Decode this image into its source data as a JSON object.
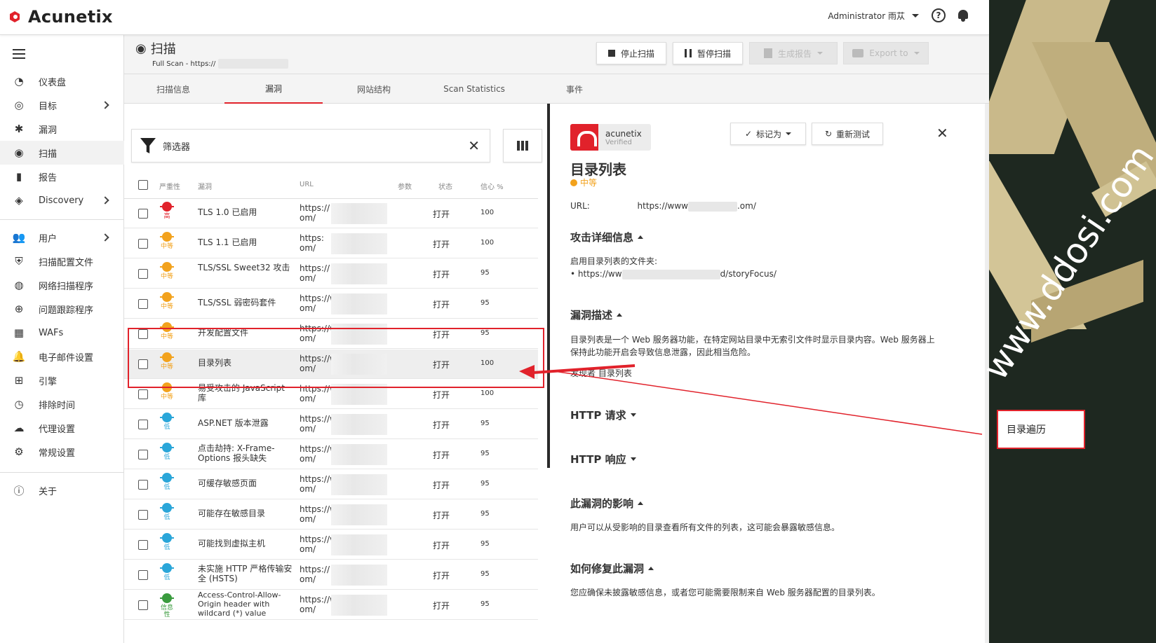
{
  "topbar": {
    "logo": "Acunetix",
    "user": "Administrator 雨苁",
    "help": "?"
  },
  "sidebar": {
    "items": [
      {
        "label": "仪表盘",
        "icon": "dashboard-icon"
      },
      {
        "label": "目标",
        "icon": "target-icon"
      },
      {
        "label": "漏洞",
        "icon": "bug-icon"
      },
      {
        "label": "扫描",
        "icon": "scan-icon"
      },
      {
        "label": "报告",
        "icon": "report-icon"
      },
      {
        "label": "Discovery",
        "icon": "compass-icon"
      },
      {
        "label": "用户",
        "icon": "users-icon"
      },
      {
        "label": "扫描配置文件",
        "icon": "shield-icon"
      },
      {
        "label": "网络扫描程序",
        "icon": "network-scanner-icon"
      },
      {
        "label": "问题跟踪程序",
        "icon": "issue-tracker-icon"
      },
      {
        "label": "WAFs",
        "icon": "waf-icon"
      },
      {
        "label": "电子邮件设置",
        "icon": "bell-icon"
      },
      {
        "label": "引擎",
        "icon": "chip-icon"
      },
      {
        "label": "排除时间",
        "icon": "clock-icon"
      },
      {
        "label": "代理设置",
        "icon": "cloud-icon"
      },
      {
        "label": "常规设置",
        "icon": "gear-icon"
      },
      {
        "label": "关于",
        "icon": "info-icon"
      }
    ]
  },
  "header": {
    "title": "扫描",
    "subtitle": "Full Scan - https://",
    "stop": "停止扫描",
    "pause": "暂停扫描",
    "report": "生成报告",
    "export": "Export to"
  },
  "tabs": [
    "扫描信息",
    "漏洞",
    "网站结构",
    "Scan Statistics",
    "事件"
  ],
  "filter": {
    "label": "筛选器"
  },
  "table": {
    "headers": {
      "severity": "严重性",
      "vuln": "漏洞",
      "url": "URL",
      "params": "参数",
      "status": "状态",
      "confidence": "信心 %"
    },
    "rows": [
      {
        "sev": "高",
        "color": "#e1222b",
        "name": "TLS 1.0 已启用",
        "url1": "https://",
        "url2": "om/",
        "status": "打开",
        "conf": "100"
      },
      {
        "sev": "中等",
        "color": "#f2a21d",
        "name": "TLS 1.1 已启用",
        "url1": "https:",
        "url2": "om/",
        "status": "打开",
        "conf": "100"
      },
      {
        "sev": "中等",
        "color": "#f2a21d",
        "name": "TLS/SSL Sweet32 攻击",
        "url1": "https://",
        "url2": "om/",
        "status": "打开",
        "conf": "95"
      },
      {
        "sev": "中等",
        "color": "#f2a21d",
        "name": "TLS/SSL 弱密码套件",
        "url1": "https://w",
        "url2": "om/",
        "status": "打开",
        "conf": "95"
      },
      {
        "sev": "中等",
        "color": "#f2a21d",
        "name": "开发配置文件",
        "url1": "https://wv",
        "url2": "om/",
        "status": "打开",
        "conf": "95"
      },
      {
        "sev": "中等",
        "color": "#f2a21d",
        "name": "目录列表",
        "url1": "https://ww",
        "url2": "om/",
        "status": "打开",
        "conf": "100"
      },
      {
        "sev": "中等",
        "color": "#f2a21d",
        "name": "易受攻击的 JavaScript 库",
        "url1": "https://ww",
        "url2": "om/",
        "status": "打开",
        "conf": "100"
      },
      {
        "sev": "低",
        "color": "#2aa6d9",
        "name": "ASP.NET 版本泄露",
        "url1": "https://wv",
        "url2": "om/",
        "status": "打开",
        "conf": "95"
      },
      {
        "sev": "低",
        "color": "#2aa6d9",
        "name": "点击劫持: X-Frame-Options 报头缺失",
        "url1": "https://wv",
        "url2": "om/",
        "status": "打开",
        "conf": "95"
      },
      {
        "sev": "低",
        "color": "#2aa6d9",
        "name": "可缓存敏感页面",
        "url1": "https://wv",
        "url2": "om/",
        "status": "打开",
        "conf": "95"
      },
      {
        "sev": "低",
        "color": "#2aa6d9",
        "name": "可能存在敏感目录",
        "url1": "https://w",
        "url2": "om/",
        "status": "打开",
        "conf": "95"
      },
      {
        "sev": "低",
        "color": "#2aa6d9",
        "name": "可能找到虚拟主机",
        "url1": "https://v",
        "url2": "om/",
        "status": "打开",
        "conf": "95"
      },
      {
        "sev": "低",
        "color": "#2aa6d9",
        "name": "未实施 HTTP 严格传输安全 (HSTS)",
        "url1": "https://",
        "url2": "om/",
        "status": "打开",
        "conf": "95"
      },
      {
        "sev": "信息性",
        "color": "#3a9b3e",
        "name": "Access-Control-Allow-Origin header with wildcard (*) value",
        "url1": "https://w",
        "url2": "om/",
        "status": "打开",
        "conf": "95"
      }
    ]
  },
  "detail": {
    "verified_brand": "acunetix",
    "verified_label": "Verified",
    "mark_as": "标记为",
    "retest": "重新测试",
    "title": "目录列表",
    "severity": "中等",
    "url_label": "URL:",
    "url_start": "https://www",
    "url_end": ".om/",
    "attack_head": "攻击详细信息",
    "attack_text": "启用目录列表的文件夹:",
    "attack_item_start": "https://ww",
    "attack_item_end": "d/storyFocus/",
    "desc_head": "漏洞描述",
    "desc_text": "目录列表是一个 Web 服务器功能，在特定网站目录中无索引文件时显示目录内容。Web 服务器上保持此功能开启会导致信息泄露，因此相当危险。",
    "found_by": "发现者 目录列表",
    "http_req": "HTTP 请求",
    "http_resp": "HTTP 响应",
    "impact_head": "此漏洞的影响",
    "impact_text": "用户可以从受影响的目录查看所有文件的列表，这可能会暴露敏感信息。",
    "fix_head": "如何修复此漏洞",
    "fix_text": "您应确保未披露敏感信息，或者您可能需要限制来自 Web 服务器配置的目录列表。"
  },
  "annotation": {
    "watermark": "www.ddosi.com",
    "callout": "目录遍历"
  }
}
